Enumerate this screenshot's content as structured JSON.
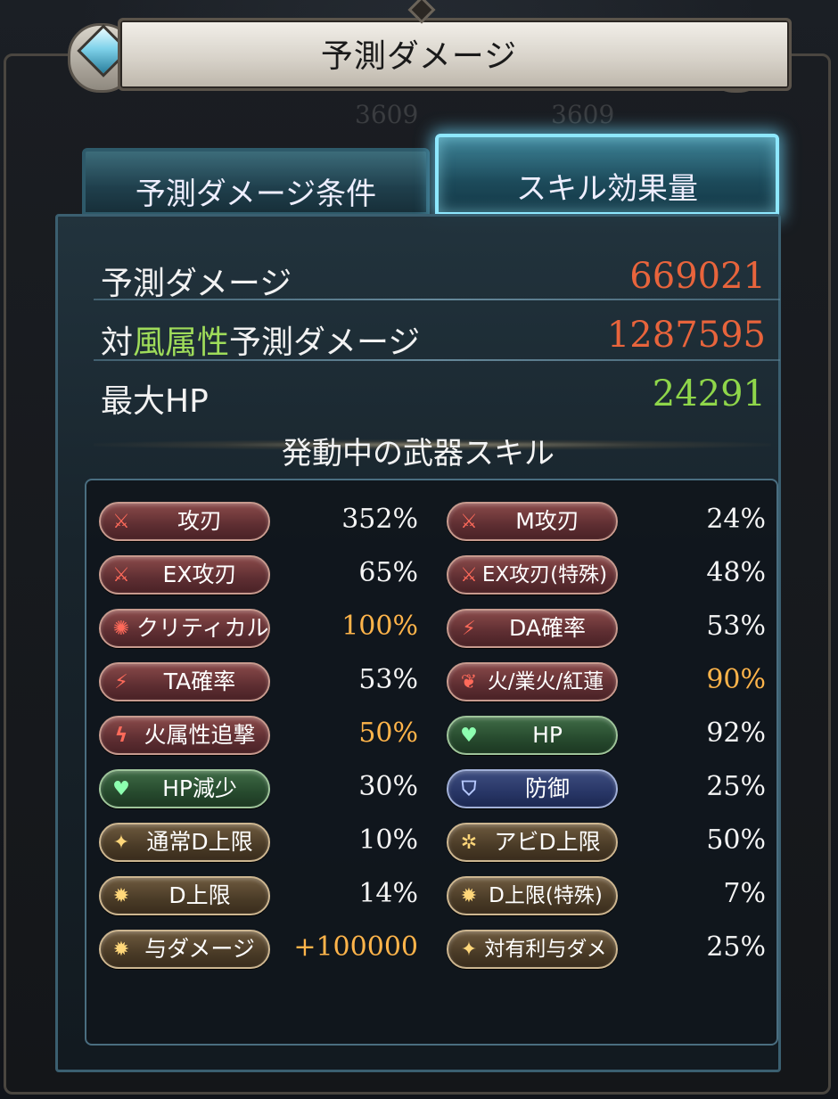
{
  "title": "予測ダメージ",
  "tabs": [
    {
      "label": "予測ダメージ条件",
      "active": false
    },
    {
      "label": "スキル効果量",
      "active": true
    }
  ],
  "stats": {
    "predicted_damage": {
      "label": "予測ダメージ",
      "value": "669021",
      "color": "#e8643c"
    },
    "vs_wind": {
      "prefix": "対",
      "element": "風属性",
      "suffix": "予測ダメージ",
      "value": "1287595",
      "color": "#e8643c",
      "element_color": "#9fdc5a"
    },
    "max_hp": {
      "label": "最大HP",
      "value": "24291",
      "color": "#8fd64a"
    }
  },
  "section_title": "発動中の武器スキル",
  "skills_left": [
    {
      "label": "攻刃",
      "value": "352%",
      "style": "red",
      "icon": "sword-icon",
      "highlight": false
    },
    {
      "label": "EX攻刃",
      "value": "65%",
      "style": "red",
      "icon": "sword-icon",
      "highlight": false
    },
    {
      "label": "クリティカル",
      "value": "100%",
      "style": "red",
      "icon": "burst-icon",
      "highlight": true
    },
    {
      "label": "TA確率",
      "value": "53%",
      "style": "red",
      "icon": "triple-slash-icon",
      "highlight": false
    },
    {
      "label": "火属性追撃",
      "value": "50%",
      "style": "red",
      "icon": "lightning-icon",
      "highlight": true
    },
    {
      "label": "HP減少",
      "value": "30%",
      "style": "green",
      "icon": "heart-icon",
      "highlight": false
    },
    {
      "label": "通常D上限",
      "value": "10%",
      "style": "gold",
      "icon": "spark-icon",
      "highlight": false
    },
    {
      "label": "D上限",
      "value": "14%",
      "style": "gold",
      "icon": "gear-icon",
      "highlight": false
    },
    {
      "label": "与ダメージ",
      "value": "+100000",
      "style": "gold",
      "icon": "gear-icon",
      "highlight": true
    }
  ],
  "skills_right": [
    {
      "label": "M攻刃",
      "value": "24%",
      "style": "red",
      "icon": "sword-icon",
      "highlight": false
    },
    {
      "label": "EX攻刃(特殊)",
      "value": "48%",
      "style": "red",
      "icon": "sword-icon",
      "highlight": false
    },
    {
      "label": "DA確率",
      "value": "53%",
      "style": "red",
      "icon": "double-slash-icon",
      "highlight": false
    },
    {
      "label": "火/業火/紅蓮",
      "value": "90%",
      "style": "red",
      "icon": "flame-icon",
      "highlight": true
    },
    {
      "label": "HP",
      "value": "92%",
      "style": "green",
      "icon": "heart-icon",
      "highlight": false
    },
    {
      "label": "防御",
      "value": "25%",
      "style": "blue",
      "icon": "shield-icon",
      "highlight": false
    },
    {
      "label": "アビD上限",
      "value": "50%",
      "style": "gold",
      "icon": "ability-icon",
      "highlight": false
    },
    {
      "label": "D上限(特殊)",
      "value": "7%",
      "style": "gold",
      "icon": "gear-icon",
      "highlight": false
    },
    {
      "label": "対有利与ダメ",
      "value": "25%",
      "style": "gold",
      "icon": "spark-icon",
      "highlight": false
    }
  ],
  "background_numbers": [
    "3609",
    "3609"
  ]
}
